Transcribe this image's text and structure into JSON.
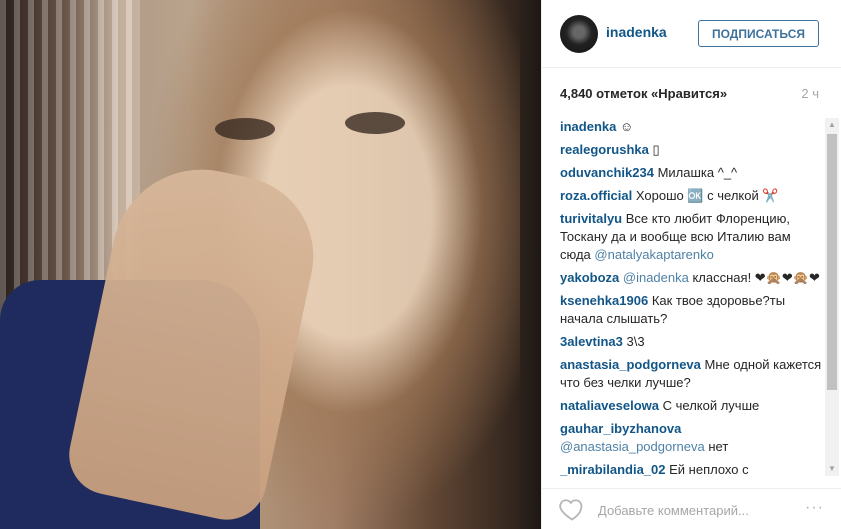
{
  "post": {
    "author": "inadenka",
    "follow_label": "ПОДПИСАТЬСЯ",
    "likes_text": "4,840 отметок «Нравится»",
    "time_ago": "2 ч"
  },
  "comments": [
    {
      "user": "inadenka",
      "text": "☺"
    },
    {
      "user": "realegorushka",
      "text": "▯"
    },
    {
      "user": "oduvanchik234",
      "text": "Милашка ^_^"
    },
    {
      "user": "roza.official",
      "text": "Хорошо 🆗 с челкой ✂️"
    },
    {
      "user": "turivitalyu",
      "text": "Все кто любит Флоренцию, Тоскану да и вообще всю Италию вам сюда",
      "mention": "@natalyakaptarenko"
    },
    {
      "user": "yakoboza",
      "mention": "@inadenka",
      "text": "классная! ❤🙊❤🙊❤"
    },
    {
      "user": "ksenehka1906",
      "text": "Как твое здоровье?ты начала слышать?"
    },
    {
      "user": "3alevtina3",
      "text": "3\\3"
    },
    {
      "user": "anastasia_podgorneva",
      "text": "Мне одной кажется что без челки лучше?"
    },
    {
      "user": "nataliaveselowa",
      "text": "С челкой лучше"
    },
    {
      "user": "gauhar_ibyzhanova",
      "mention": "@anastasia_podgorneva",
      "text": "нет"
    },
    {
      "user": "_mirabilandia_02",
      "text": "Ей неплохо с"
    }
  ],
  "footer": {
    "comment_placeholder": "Добавьте комментарий...",
    "more_label": "···"
  },
  "icons": {
    "like": "heart-icon",
    "scroll_up": "arrow-up-icon",
    "scroll_down": "arrow-down-icon"
  }
}
